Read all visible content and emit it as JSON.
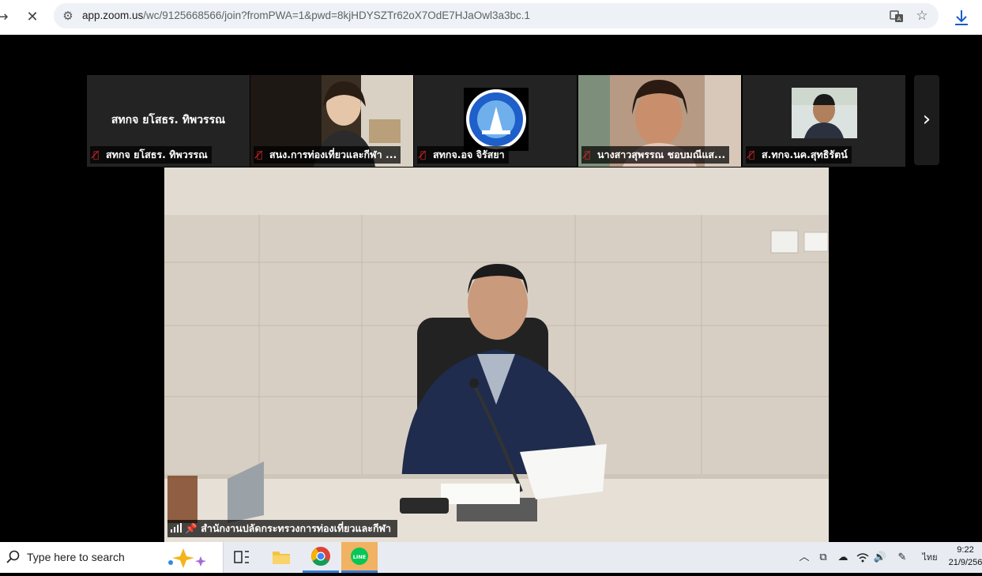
{
  "browser": {
    "url_domain": "app.zoom.us",
    "url_path": "/wc/9125668566/join?fromPWA=1&pwd=8kjHDYSZTr62oX7OdE7HJaOwl3a3bc.1",
    "back_icon": "arrow-right-icon",
    "stop_icon": "close-icon"
  },
  "gallery": {
    "tiles": [
      {
        "center_name": "สทกจ ยโสธร. ทิพวรรณ",
        "label": "สทกจ ยโสธร. ทิพวรรณ"
      },
      {
        "label": "สนง.การท่องเที่ยวและกีฬา ..."
      },
      {
        "label": "สทกจ.อจ จิรัสยา"
      },
      {
        "label": "นางสาวสุพรรณ ชอบมณีแส..."
      },
      {
        "label": "ส.ทกจ.นค.สุทธิรัตน์"
      }
    ]
  },
  "main_video": {
    "speaker_label": "สำนักงานปลัดกระทรวงการท่องเที่ยวและกีฬา"
  },
  "taskbar": {
    "search_placeholder": "Type here to search",
    "language": "ไทย",
    "time": "9:22",
    "date": "21/9/256"
  }
}
